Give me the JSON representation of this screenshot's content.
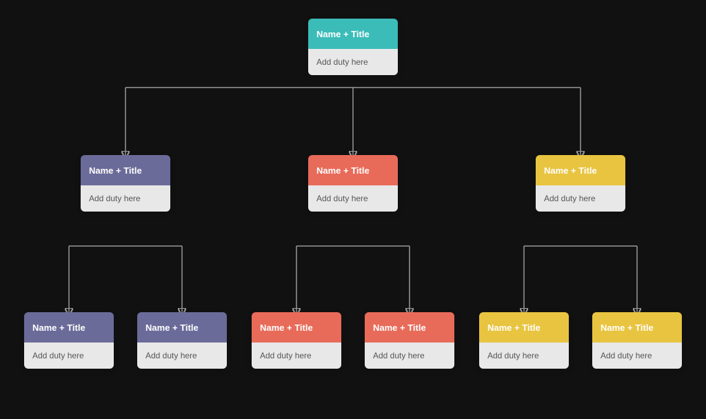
{
  "colors": {
    "teal": "#3bbcb8",
    "purple": "#6b6b9a",
    "coral": "#e86b5a",
    "yellow": "#e8c440",
    "bg": "#111"
  },
  "nodes": {
    "root": {
      "label": "Name + Title",
      "duty": "Add duty here",
      "color": "teal"
    },
    "mid_left": {
      "label": "Name + Title",
      "duty": "Add duty here",
      "color": "purple"
    },
    "mid_center": {
      "label": "Name + Title",
      "duty": "Add duty here",
      "color": "coral"
    },
    "mid_right": {
      "label": "Name + Title",
      "duty": "Add duty here",
      "color": "yellow"
    },
    "bot_ll": {
      "label": "Name + Title",
      "duty": "Add duty here",
      "color": "purple"
    },
    "bot_lr": {
      "label": "Name + Title",
      "duty": "Add duty here",
      "color": "purple"
    },
    "bot_cl": {
      "label": "Name + Title",
      "duty": "Add duty here",
      "color": "coral"
    },
    "bot_cr": {
      "label": "Name + Title",
      "duty": "Add duty here",
      "color": "coral"
    },
    "bot_rl": {
      "label": "Name + Title",
      "duty": "Add duty here",
      "color": "yellow"
    },
    "bot_rr": {
      "label": "Name + Title",
      "duty": "Add duty here",
      "color": "yellow"
    }
  }
}
